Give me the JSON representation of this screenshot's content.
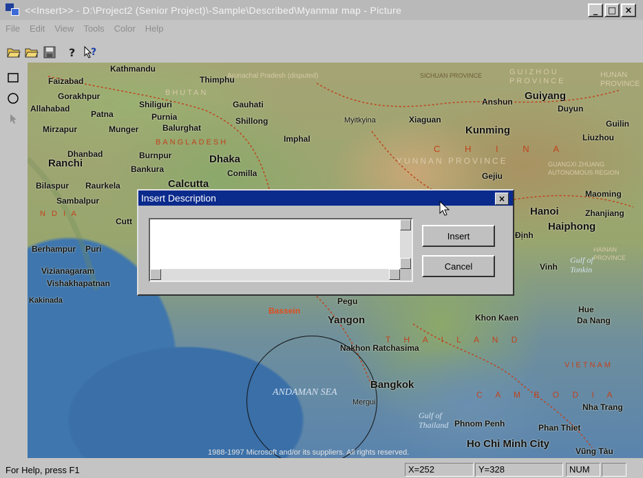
{
  "titlebar": {
    "title": "<<Insert>> - D:\\Project2 (Senior Project)\\-Sample\\Described\\Myanmar map - Picture",
    "buttons": [
      "_",
      "□",
      "×"
    ]
  },
  "menu": [
    "File",
    "Edit",
    "View",
    "Tools",
    "Color",
    "Help"
  ],
  "toolbar": {
    "icons": [
      "open-folder-icon",
      "open-folder-2-icon",
      "save-icon",
      "help-icon",
      "context-help-icon"
    ]
  },
  "toolbox": {
    "icons": [
      "rectangle-tool-icon",
      "circle-tool-icon",
      "pointer-tool-icon"
    ]
  },
  "map": {
    "labels": {
      "kathmandu": "Kathmandu",
      "faizabad": "Faizabad",
      "gorakhpur": "Gorakhpur",
      "allahabad": "Allahabad",
      "patna": "Patna",
      "shiliguri": "Shiliguri",
      "thimphu": "Thimphu",
      "bhutan": "BHUTAN",
      "arunachal": "Arunachal Pradesh (disputed)",
      "mirzapur": "Mirzapur",
      "munger": "Munger",
      "purnia": "Purnia",
      "balurghat": "Balurghat",
      "gauhati": "Gauhati",
      "shillong": "Shillong",
      "bangladesh": "BANGLADESH",
      "dhanbad": "Dhanbad",
      "ranchi": "Ranchi",
      "burnpur": "Burnpur",
      "bankura": "Bankura",
      "dhaka": "Dhaka",
      "imphal": "Imphal",
      "comilla": "Comilla",
      "calcutta": "Calcutta",
      "bilaspur": "Bilaspur",
      "raurkela": "Raurkela",
      "sambalpur": "Sambalpur",
      "india": "N D I A",
      "cuttack": "Cutt",
      "berhampur": "Berhampur",
      "puri": "Puri",
      "vizianagaram": "Vizianagaram",
      "vishakhapatnam": "Vishakhapatnan",
      "kakinada": "Kakinada",
      "myitkyina": "Myitkyina",
      "xiaguan": "Xiaguan",
      "anshun": "Anshun",
      "guiyang": "Guiyang",
      "duyun": "Duyun",
      "guilin": "Guilin",
      "liuzhou": "Liuzhou",
      "kunming": "Kunming",
      "china": "C H I N A",
      "yunnan": "YUNNAN PROVINCE",
      "gejiu": "Gejiu",
      "sichuan": "SICHUAN PROVINCE",
      "guizhou": "GUIZHOU PROVINCE",
      "hunan": "HUNAN PROVINCE",
      "guangxi": "GUANGXI ZHUANG AUTONOMOUS REGION",
      "maoming": "Maoming",
      "hanoi": "Hanoi",
      "zhanjiang": "Zhanjiang",
      "haiphong": "Haiphong",
      "hainan": "HAINAN PROVINCE",
      "dinh": "Định",
      "vinh": "Vinh",
      "gulf_tonkin": "Gulf of Tonkin",
      "pegu": "Pegu",
      "bassein": "Bassein",
      "yangon": "Yangon",
      "khon_kaen": "Khon Kaen",
      "hue": "Hue",
      "da_nang": "Da Nang",
      "thailand": "T H A I L A N D",
      "nakhon": "Nakhon Ratchasima",
      "andaman": "ANDAMAN SEA",
      "bangkok": "Bangkok",
      "mergui": "Mergui",
      "vietnam": "VIETNAM",
      "cambodia": "C A M B O D I A",
      "nha_trang": "Nha Trang",
      "gulf_thailand": "Gulf of Thailand",
      "phnom_penh": "Phnom Penh",
      "phan_thiet": "Phan Thiet",
      "ho_chi_minh": "Ho Chi Minh City",
      "vung_tau": "Vũng Tàu",
      "copyright": "1988-1997 Microsoft and/or its suppliers. All rights reserved."
    }
  },
  "dialog": {
    "title": "Insert Description",
    "close": "×",
    "textarea_value": "",
    "insert_label": "Insert",
    "cancel_label": "Cancel"
  },
  "statusbar": {
    "help": "For Help, press F1",
    "x": "X=252",
    "y": "Y=328",
    "num": "NUM"
  }
}
